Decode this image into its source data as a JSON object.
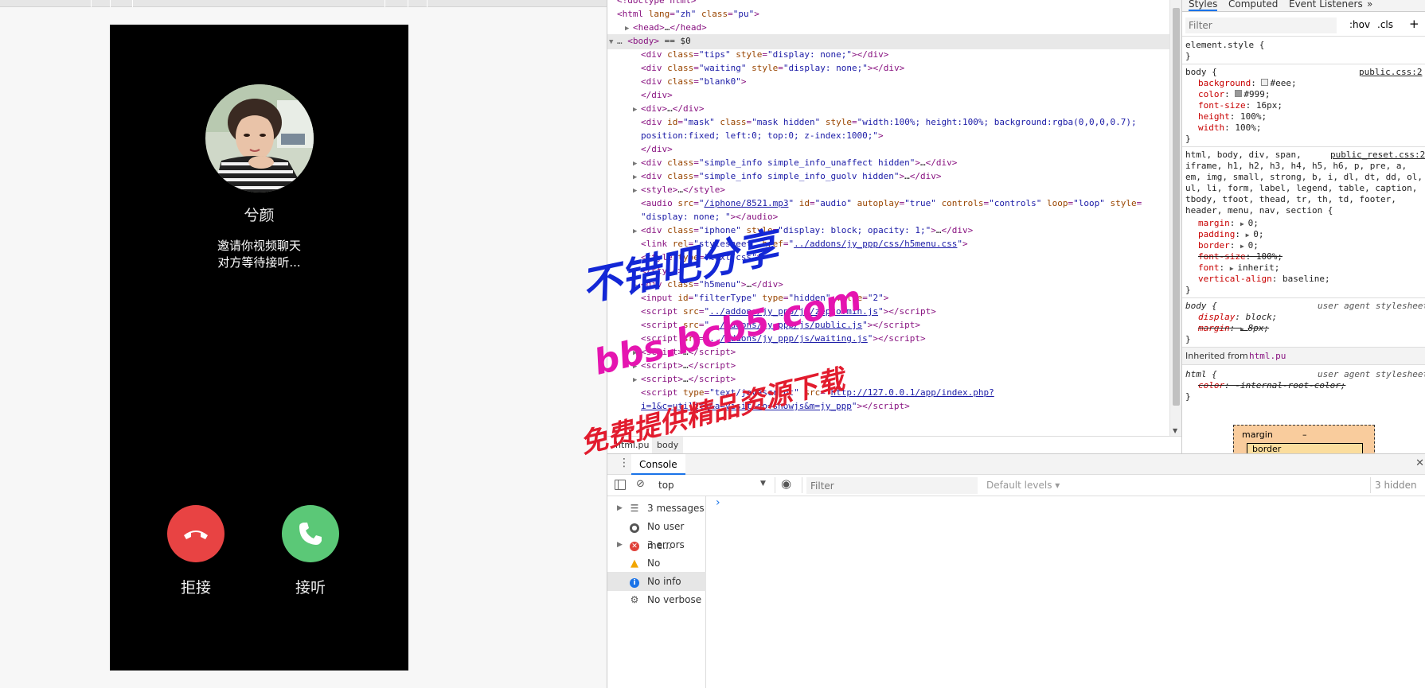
{
  "phone": {
    "caller_name": "兮颜",
    "invite_line1": "邀请你视频聊天",
    "invite_line2": "对方等待接听...",
    "decline_label": "拒接",
    "accept_label": "接听",
    "decline_color": "#e84343",
    "accept_color": "#5bc877"
  },
  "elements": {
    "lines": [
      {
        "indent": 0,
        "tri": "",
        "html": "&lt;!doctype html&gt;"
      },
      {
        "indent": 0,
        "tri": "",
        "html": "<span class='tag'>&lt;html</span> <span class='attr'>lang</span>=<span class='val'>\"zh\"</span> <span class='attr'>class</span>=<span class='val'>\"pu\"</span><span class='tag'>&gt;</span>"
      },
      {
        "indent": 1,
        "tri": "▶",
        "html": "<span class='tag'>&lt;head&gt;</span><span class='txt'>…</span><span class='tag'>&lt;/head&gt;</span>"
      },
      {
        "indent": 1,
        "tri": "▼",
        "sel": true,
        "html": "<span class='tag'>&lt;body&gt;</span> <span class='txt'>== $0</span>"
      },
      {
        "indent": 3,
        "tri": "",
        "html": "<span class='tag'>&lt;div</span> <span class='attr'>class</span>=<span class='val'>\"tips\"</span> <span class='attr'>style</span>=<span class='val'>\"display: none;\"</span><span class='tag'>&gt;&lt;/div&gt;</span>"
      },
      {
        "indent": 3,
        "tri": "",
        "html": "<span class='tag'>&lt;div</span> <span class='attr'>class</span>=<span class='val'>\"waiting\"</span> <span class='attr'>style</span>=<span class='val'>\"display: none;\"</span><span class='tag'>&gt;&lt;/div&gt;</span>"
      },
      {
        "indent": 3,
        "tri": "",
        "html": "<span class='tag'>&lt;div</span> <span class='attr'>class</span>=<span class='val'>\"blank0\"</span><span class='tag'>&gt;</span>"
      },
      {
        "indent": 3,
        "tri": "",
        "html": "<span class='tag'>&lt;/div&gt;</span>"
      },
      {
        "indent": 2,
        "tri": "▶",
        "html": "<span class='tag'>&lt;div&gt;</span><span class='txt'>…</span><span class='tag'>&lt;/div&gt;</span>"
      },
      {
        "indent": 3,
        "tri": "",
        "html": "<span class='tag'>&lt;div</span> <span class='attr'>id</span>=<span class='val'>\"mask\"</span> <span class='attr'>class</span>=<span class='val'>\"mask hidden\"</span> <span class='attr'>style</span>=<span class='val'>\"width:100%; height:100%; background:rgba(0,0,0,0.7);</span>"
      },
      {
        "indent": 3,
        "tri": "",
        "html": "<span class='val'>position:fixed; left:0; top:0; z-index:1000;\"</span><span class='tag'>&gt;</span>"
      },
      {
        "indent": 3,
        "tri": "",
        "html": "<span class='tag'>&lt;/div&gt;</span>"
      },
      {
        "indent": 2,
        "tri": "▶",
        "html": "<span class='tag'>&lt;div</span> <span class='attr'>class</span>=<span class='val'>\"simple_info simple_info_unaffect hidden\"</span><span class='tag'>&gt;</span><span class='txt'>…</span><span class='tag'>&lt;/div&gt;</span>"
      },
      {
        "indent": 2,
        "tri": "▶",
        "html": "<span class='tag'>&lt;div</span> <span class='attr'>class</span>=<span class='val'>\"simple_info simple_info_guolv hidden\"</span><span class='tag'>&gt;</span><span class='txt'>…</span><span class='tag'>&lt;/div&gt;</span>"
      },
      {
        "indent": 2,
        "tri": "▶",
        "html": "<span class='tag'>&lt;style&gt;</span><span class='txt'>…</span><span class='tag'>&lt;/style&gt;</span>"
      },
      {
        "indent": 3,
        "tri": "",
        "html": "<span class='tag'>&lt;audio</span> <span class='attr'>src</span>=<span class='val'>\"<span class='link'>/iphone/8521.mp3</span>\"</span> <span class='attr'>id</span>=<span class='val'>\"audio\"</span> <span class='attr'>autoplay</span>=<span class='val'>\"true\"</span> <span class='attr'>controls</span>=<span class='val'>\"controls\"</span> <span class='attr'>loop</span>=<span class='val'>\"loop\"</span> <span class='attr'>style</span>="
      },
      {
        "indent": 3,
        "tri": "",
        "html": "<span class='val'>\"display: none;  \"</span><span class='tag'>&gt;&lt;/audio&gt;</span>"
      },
      {
        "indent": 2,
        "tri": "▶",
        "html": "<span class='tag'>&lt;div</span> <span class='attr'>class</span>=<span class='val'>\"iphone\"</span> <span class='attr'>style</span>=<span class='val'>\"display: block; opacity: 1;\"</span><span class='tag'>&gt;</span><span class='txt'>…</span><span class='tag'>&lt;/div&gt;</span>"
      },
      {
        "indent": 3,
        "tri": "",
        "html": "<span class='tag'>&lt;link</span> <span class='attr'>rel</span>=<span class='val'>\"stylesheet\"</span> <span class='attr'>href</span>=<span class='val'>\"<span class='link'>../addons/jy_ppp/css/h5menu.css</span>\"</span><span class='tag'>&gt;</span>"
      },
      {
        "indent": 3,
        "tri": "",
        "html": "<span class='tag'>&lt;style</span> <span class='attr'>type</span>=<span class='val'>\"text/css\"</span><span class='tag'>&gt;</span>"
      },
      {
        "indent": 3,
        "tri": "",
        "html": "<span class='tag'>&lt;/style&gt;</span>"
      },
      {
        "indent": 2,
        "tri": "▶",
        "html": "<span class='tag'>&lt;div</span> <span class='attr'>class</span>=<span class='val'>\"h5menu\"</span><span class='tag'>&gt;</span><span class='txt'>…</span><span class='tag'>&lt;/div&gt;</span>"
      },
      {
        "indent": 3,
        "tri": "",
        "html": "<span class='tag'>&lt;input</span> <span class='attr'>id</span>=<span class='val'>\"filterType\"</span> <span class='attr'>type</span>=<span class='val'>\"hidden\"</span> <span class='attr'>value</span>=<span class='val'>\"2\"</span><span class='tag'>&gt;</span>"
      },
      {
        "indent": 3,
        "tri": "",
        "html": "<span class='tag'>&lt;script</span> <span class='attr'>src</span>=<span class='val'>\"<span class='link'>../addons/jy_ppp/js/zepto.min.js</span>\"</span><span class='tag'>&gt;&lt;/script&gt;</span>"
      },
      {
        "indent": 3,
        "tri": "",
        "html": "<span class='tag'>&lt;script</span> <span class='attr'>src</span>=<span class='val'>\"<span class='link'>../addons/jy_ppp/js/public.js</span>\"</span><span class='tag'>&gt;&lt;/script&gt;</span>"
      },
      {
        "indent": 3,
        "tri": "",
        "html": "<span class='tag'>&lt;script</span> <span class='attr'>src</span>=<span class='val'>\"<span class='link'>../addons/jy_ppp/js/waiting.js</span>\"</span><span class='tag'>&gt;&lt;/script&gt;</span>"
      },
      {
        "indent": 2,
        "tri": "▶",
        "html": "<span class='tag'>&lt;script&gt;</span><span class='txt'>…</span><span class='tag'>&lt;/script&gt;</span>"
      },
      {
        "indent": 2,
        "tri": "▶",
        "html": "<span class='tag'>&lt;script&gt;</span><span class='txt'>…</span><span class='tag'>&lt;/script&gt;</span>"
      },
      {
        "indent": 2,
        "tri": "▶",
        "html": "<span class='tag'>&lt;script&gt;</span><span class='txt'>…</span><span class='tag'>&lt;/script&gt;</span>"
      },
      {
        "indent": 3,
        "tri": "",
        "html": "<span class='tag'>&lt;script</span> <span class='attr'>type</span>=<span class='val'>\"text/javascript\"</span> <span class='attr'>src</span>=<span class='val'>\"<span class='link'>http://127.0.0.1/app/index.php?</span></span>"
      },
      {
        "indent": 3,
        "tri": "",
        "html": "<span class='val'><span class='link'>i=1&amp;c=utility&amp;a=visit&amp;do=showjs&amp;m=jy_ppp</span>\"</span><span class='tag'>&gt;&lt;/script&gt;</span>"
      }
    ]
  },
  "breadcrumb": {
    "items": [
      "html.pu",
      "body"
    ]
  },
  "styles": {
    "tabs": [
      "Styles",
      "Computed",
      "Event Listeners",
      "»"
    ],
    "filter_placeholder": "Filter",
    "hov": ":hov",
    "cls": ".cls",
    "plus": "+",
    "element_style": "element.style {",
    "close_brace": "}",
    "body_selector": "body {",
    "body_source": "public.css:2",
    "body_props": [
      {
        "name": "background",
        "value": "#eee",
        "swatch": "#eeeeee"
      },
      {
        "name": "color",
        "value": "#999",
        "swatch": "#999999"
      },
      {
        "name": "font-size",
        "value": "16px"
      },
      {
        "name": "height",
        "value": "100%"
      },
      {
        "name": "width",
        "value": "100%"
      }
    ],
    "reset_selector_lines": [
      "html, body, div, span,",
      "iframe, h1, h2, h3, h4, h5, h6, p, pre, a,",
      "em, img, small, strong, b, i, dl, dt, dd, ol,",
      "ul, li, form, label, legend, table, caption,",
      "tbody, tfoot, thead, tr, th, td, footer,",
      "header, menu, nav, section {"
    ],
    "reset_source": "public_reset.css:2",
    "reset_props": [
      {
        "name": "margin",
        "value": "0",
        "arrow": true
      },
      {
        "name": "padding",
        "value": "0",
        "arrow": true
      },
      {
        "name": "border",
        "value": "0",
        "arrow": true
      },
      {
        "name": "font-size",
        "value": "100%",
        "strike": true
      },
      {
        "name": "font",
        "value": "inherit",
        "arrow": true
      },
      {
        "name": "vertical-align",
        "value": "baseline"
      }
    ],
    "ua_label": "user agent stylesheet",
    "ua_body_selector": "body {",
    "ua_body_props": [
      {
        "name": "display",
        "value": "block"
      },
      {
        "name": "margin",
        "value": "8px",
        "strike": true,
        "arrow": true
      }
    ],
    "inherited_label": "Inherited from",
    "inherited_from": "html.pu",
    "ua_html_selector": "html {",
    "ua_html_props": [
      {
        "name": "color",
        "value": "-internal-root-color",
        "strike": true
      }
    ],
    "box_margin": "margin",
    "box_dash": "–",
    "box_border": "border"
  },
  "console": {
    "tab": "Console",
    "context": "top",
    "filter_placeholder": "Filter",
    "levels": "Default levels ▾",
    "hidden": "3 hidden",
    "prompt": "›",
    "sidebar": [
      {
        "label": "3 messages",
        "icon": "list",
        "arrow": true
      },
      {
        "label": "No user me...",
        "icon": "user",
        "arrow": false
      },
      {
        "label": "3 errors",
        "icon": "error",
        "arrow": true
      },
      {
        "label": "No warnings",
        "icon": "warning",
        "arrow": false
      },
      {
        "label": "No info",
        "icon": "info",
        "arrow": false,
        "selected": true
      },
      {
        "label": "No verbose",
        "icon": "verbose",
        "arrow": false
      }
    ]
  },
  "watermark": {
    "line1": "不错吧分享",
    "line2": "bbs.bcb5.com",
    "line3": "免费提供精品资源下载"
  }
}
